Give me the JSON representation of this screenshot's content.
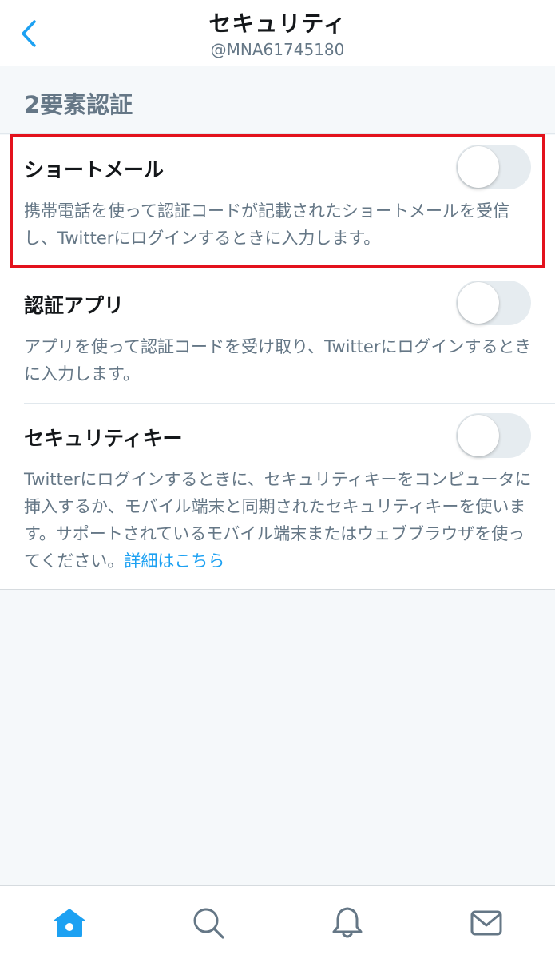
{
  "header": {
    "title": "セキュリティ",
    "subtitle": "@MNA61745180"
  },
  "section": {
    "title": "2要素認証"
  },
  "settings": [
    {
      "title": "ショートメール",
      "description": "携帯電話を使って認証コードが記載されたショートメールを受信し、Twitterにログインするときに入力します。",
      "enabled": false
    },
    {
      "title": "認証アプリ",
      "description": "アプリを使って認証コードを受け取り、Twitterにログインするときに入力します。",
      "enabled": false
    },
    {
      "title": "セキュリティキー",
      "description": "Twitterにログインするときに、セキュリティキーをコンピュータに挿入するか、モバイル端末と同期されたセキュリティキーを使います。サポートされているモバイル端末またはウェブブラウザを使ってください。",
      "link": "詳細はこちら",
      "enabled": false
    }
  ],
  "tabbar": {
    "items": [
      "home-icon",
      "search-icon",
      "bell-icon",
      "mail-icon"
    ],
    "active": "home-icon"
  },
  "colors": {
    "accent": "#1da1f2",
    "highlight": "#e3121c",
    "text_secondary": "#657786"
  }
}
